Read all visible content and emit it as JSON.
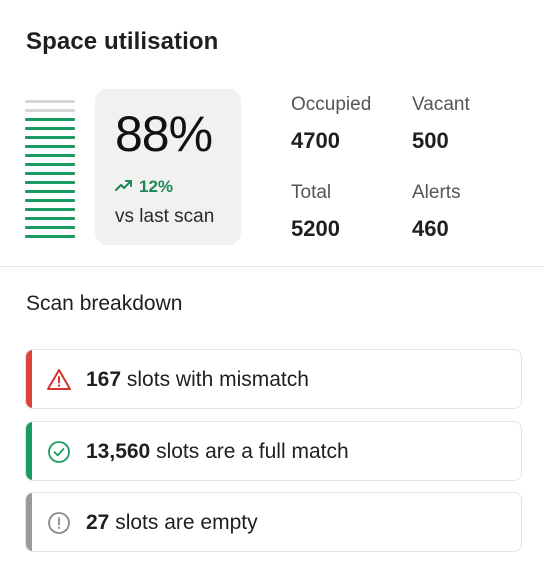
{
  "card": {
    "title": "Space utilisation",
    "utilisation": {
      "percent_label": "88%",
      "percent_value": 0.88,
      "delta_label": "12%",
      "delta_caption": "vs last scan",
      "trend_icon": "trending-up-icon"
    },
    "stats": [
      {
        "label": "Occupied",
        "value": "4700"
      },
      {
        "label": "Vacant",
        "value": "500"
      },
      {
        "label": "Total",
        "value": "5200"
      },
      {
        "label": "Alerts",
        "value": "460"
      }
    ]
  },
  "breakdown": {
    "title": "Scan breakdown",
    "rows": [
      {
        "count": "167",
        "text": "slots with mismatch",
        "icon": "warning-triangle-icon",
        "accent_color": "#e0413a"
      },
      {
        "count": "13,560",
        "text": "slots are a full match",
        "icon": "check-circle-icon",
        "accent_color": "#1a9b62"
      },
      {
        "count": "27",
        "text": "slots are empty",
        "icon": "info-circle-icon",
        "accent_color": "#9a9a9a"
      }
    ]
  },
  "colors": {
    "occupied_bar": "#1a9b62",
    "vacant_bar": "#d3d7dc",
    "positive": "#1a8a55"
  }
}
